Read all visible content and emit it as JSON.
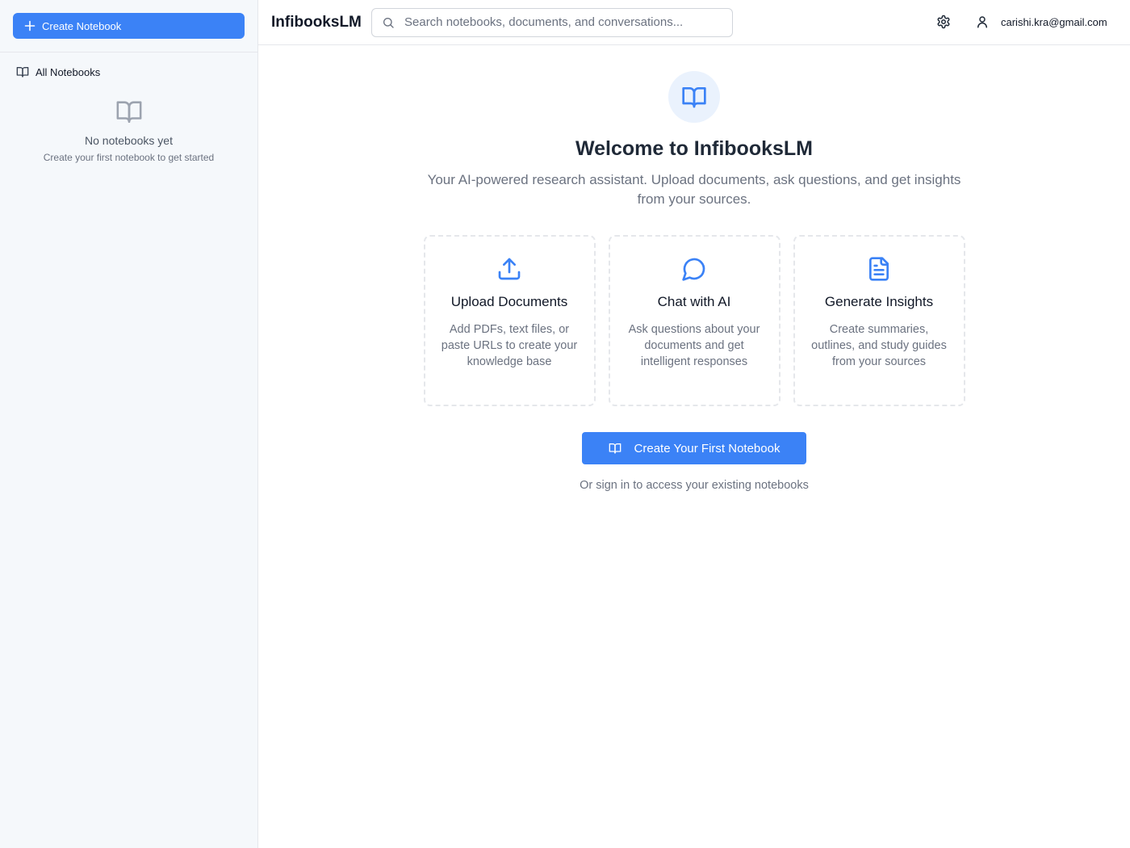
{
  "sidebar": {
    "create_button_label": "Create Notebook",
    "nav_all_notebooks": "All Notebooks",
    "empty_title": "No notebooks yet",
    "empty_subtitle": "Create your first notebook to get started"
  },
  "header": {
    "brand": "InfibooksLM",
    "search_placeholder": "Search notebooks, documents, and conversations...",
    "user_email": "carishi.kra@gmail.com"
  },
  "main": {
    "title": "Welcome to InfibooksLM",
    "subtitle": "Your AI-powered research assistant. Upload documents, ask questions, and get insights from your sources.",
    "cards": [
      {
        "icon": "upload-icon",
        "title": "Upload Documents",
        "description": "Add PDFs, text files, or paste URLs to create your knowledge base"
      },
      {
        "icon": "chat-bubble-icon",
        "title": "Chat with AI",
        "description": "Ask questions about your documents and get intelligent responses"
      },
      {
        "icon": "document-icon",
        "title": "Generate Insights",
        "description": "Create summaries, outlines, and study guides from your sources"
      }
    ],
    "cta_label": "Create Your First Notebook",
    "signin_text": "Or sign in to access your existing notebooks"
  },
  "colors": {
    "accent": "#3b82f6",
    "sidebar_bg": "#f5f8fb",
    "hero_icon_bg": "#eaf2fd"
  }
}
